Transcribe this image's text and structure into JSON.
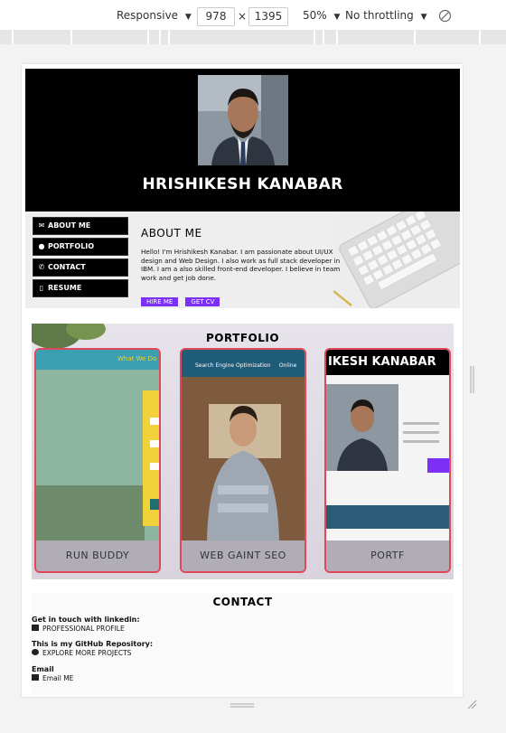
{
  "devtools": {
    "device": "Responsive",
    "width": "978",
    "times": "×",
    "height": "1395",
    "zoom": "50%",
    "throttling": "No throttling"
  },
  "hero": {
    "name": "HRISHIKESH KANABAR"
  },
  "nav": {
    "items": [
      {
        "label": "ABOUT ME",
        "icon": "envelope-icon"
      },
      {
        "label": "PORTFOLIO",
        "icon": "chat-icon"
      },
      {
        "label": "CONTACT",
        "icon": "phone-icon"
      },
      {
        "label": "RESUME",
        "icon": "mobile-icon"
      }
    ]
  },
  "about": {
    "title": "ABOUT ME",
    "text": "Hello! I'm Hrishikesh Kanabar. I am passionate about UI/UX design and Web Design. I also work as full stack developer in IBM. I am a also skilled front-end developer. I believe in team work and get job done.",
    "hire_label": "HIRE ME",
    "cv_label": "GET CV"
  },
  "portfolio": {
    "title": "PORTFOLIO",
    "cards": [
      {
        "caption": "RUN BUDDY",
        "banner": "What We Do"
      },
      {
        "caption": "WEB GAINT SEO",
        "banner": "Search Engine Optimization     Online"
      },
      {
        "caption": "PORTF",
        "banner": "IKESH KANABAR"
      }
    ]
  },
  "contact": {
    "title": "CONTACT",
    "linkedin_label": "Get in touch with linkedin:",
    "linkedin_link": "PROFESSIONAL PROFILE",
    "github_label": "This is my GitHub Repository:",
    "github_link": "EXPLORE MORE PROJECTS",
    "email_label": "Email",
    "email_link": "Email ME"
  },
  "colors": {
    "accent": "#7b2ff7",
    "card_border": "#e0485a",
    "hero_bg": "#000000"
  }
}
